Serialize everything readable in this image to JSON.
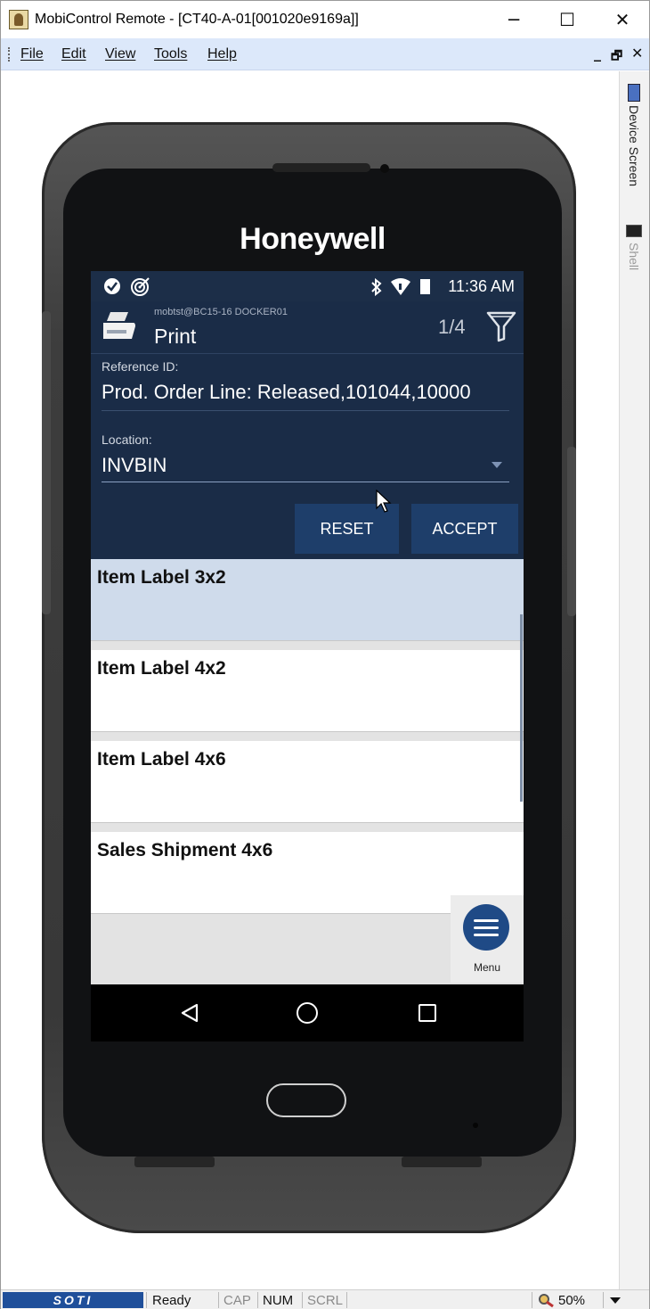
{
  "window": {
    "title": "MobiControl Remote - [CT40-A-01[001020e9169a]]",
    "minimize": "─",
    "maximize": "☐",
    "close": "✕"
  },
  "menu": {
    "items": [
      "File",
      "Edit",
      "View",
      "Tools",
      "Help"
    ],
    "mdi_minimize": "_",
    "mdi_restore": "🗗",
    "mdi_close": "✕"
  },
  "side_tabs": {
    "device_screen": "Device Screen",
    "shell": "Shell"
  },
  "device": {
    "brand": "Honeywell"
  },
  "android_status": {
    "time": "11:36 AM"
  },
  "app": {
    "user_line": "mobtst@BC15-16 DOCKER01",
    "title": "Print",
    "counter": "1/4",
    "reference_label": "Reference ID:",
    "reference_value": "Prod. Order Line: Released,101044,10000",
    "location_label": "Location:",
    "location_value": "INVBIN",
    "reset_label": "RESET",
    "accept_label": "ACCEPT",
    "list_items": [
      "Item Label 3x2",
      "Item Label 4x2",
      "Item Label 4x6",
      "Sales Shipment 4x6"
    ],
    "menu_label": "Menu"
  },
  "statusbar": {
    "soti": "SOTI",
    "ready": "Ready",
    "cap": "CAP",
    "num": "NUM",
    "scrl": "SCRL",
    "zoom": "50%"
  },
  "colors": {
    "app_header": "#1a2c47",
    "button": "#1e3e6a",
    "selected_row": "#cfdbeb",
    "menubar": "#dce8fa"
  }
}
